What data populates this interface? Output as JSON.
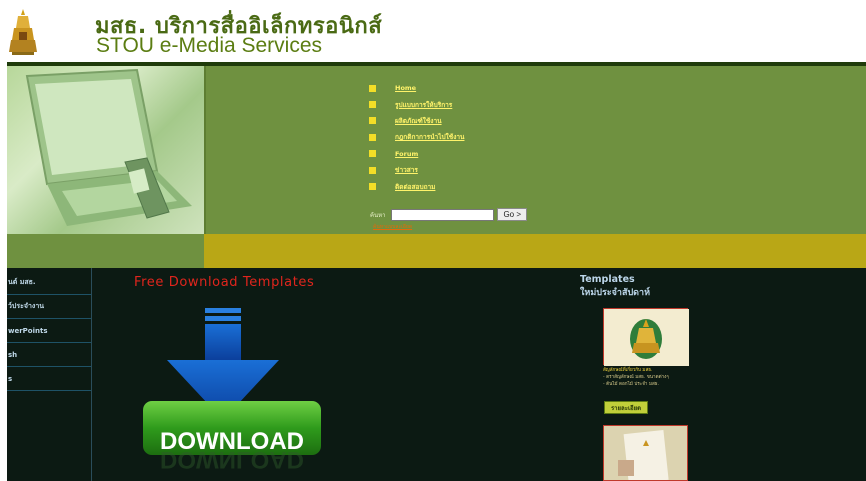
{
  "header": {
    "title_thai": "มสธ. บริการสื่ออิเล็กทรอนิกส์",
    "title_english": "STOU e-Media Services"
  },
  "nav": {
    "items": [
      {
        "label": "Home"
      },
      {
        "label": "รูปแบบการให้บริการ"
      },
      {
        "label": "ผลิตภัณฑ์ใช้งาน"
      },
      {
        "label": "กฎกติกาการนำไปใช้งาน"
      },
      {
        "label": "Forum"
      },
      {
        "label": "ข่าวสาร"
      },
      {
        "label": "ติดต่อสอบถาม"
      }
    ]
  },
  "search": {
    "label": "ค้นหา",
    "button_label": "Go >",
    "input_value": "",
    "sub_link": "ค้นหาแบบละเอียด"
  },
  "sidebar": {
    "items": [
      {
        "label": "นต์ มสธ."
      },
      {
        "label": "ว์ประจำงาน"
      },
      {
        "label": "werPoints"
      },
      {
        "label": "sh"
      },
      {
        "label": "s"
      }
    ]
  },
  "main": {
    "title": "Free Download Templates",
    "download_label": "DOWNLOAD"
  },
  "right": {
    "title_line1": "Templates",
    "title_line2": "ใหม่ประจำสัปดาห์",
    "desc_line1": "สัญลักษณ์ที่เกี่ยวกับ มสธ.",
    "desc_line2": "- ตราสัญลักษณ์ มสธ. ขนาดต่างๆ",
    "desc_line3": "- ต้นไม้ ดอกไม้ ประจำ มสธ.",
    "detail_button": "รายละเอียด"
  },
  "colors": {
    "banner_green": "#6f9140",
    "banner_olive": "#b9a716",
    "content_dark": "#0c1a13",
    "title_red": "#e0251d",
    "nav_link": "#fff36a"
  }
}
